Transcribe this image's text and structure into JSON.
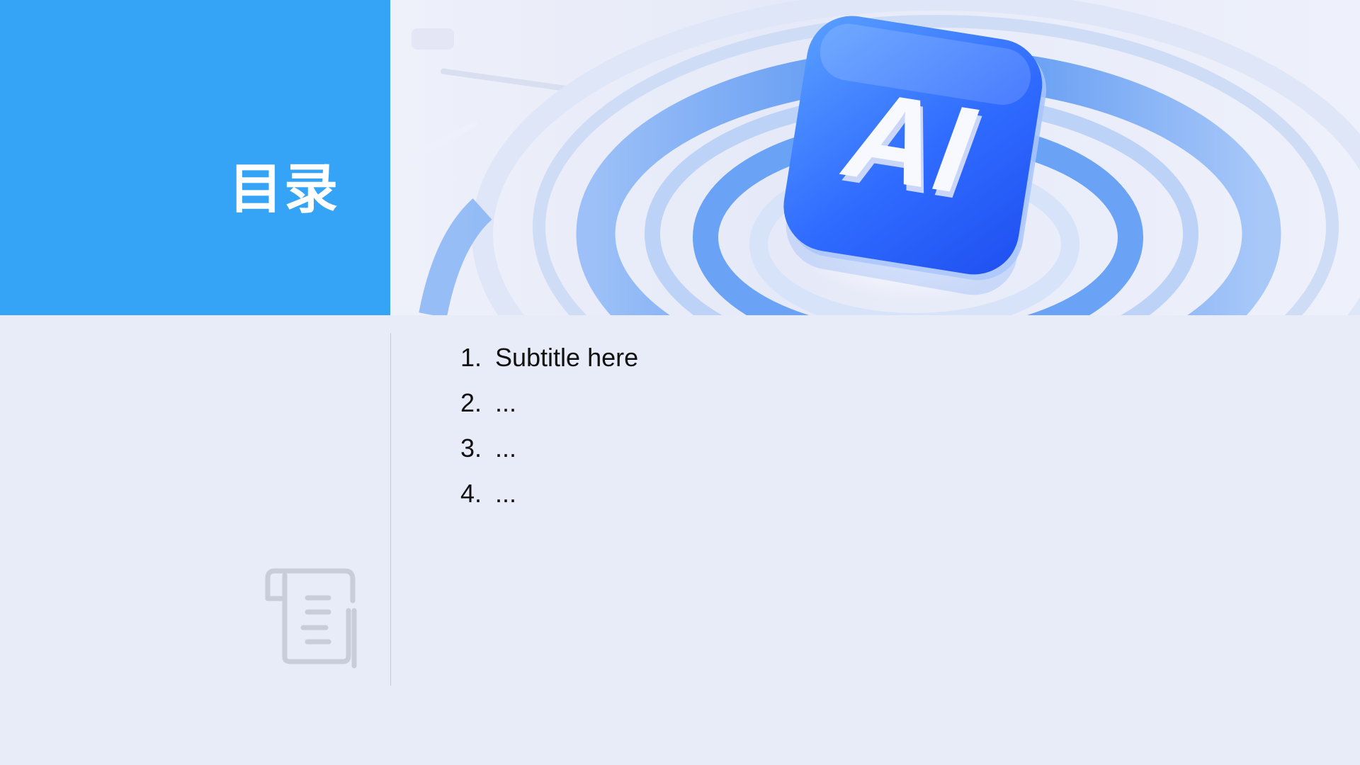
{
  "slide": {
    "title": "目录",
    "hero_badge_text": "AI",
    "toc": [
      {
        "number": "1.",
        "text": "Subtitle here"
      },
      {
        "number": "2.",
        "text": "..."
      },
      {
        "number": "3.",
        "text": "..."
      },
      {
        "number": "4.",
        "text": "..."
      }
    ]
  },
  "colors": {
    "accent": "#36a4f6",
    "background": "#e8ebf8",
    "badge_blue": "#2f6bff"
  },
  "icons": {
    "hero": "ai-badge-icon",
    "decorative": "document-scroll-icon"
  }
}
